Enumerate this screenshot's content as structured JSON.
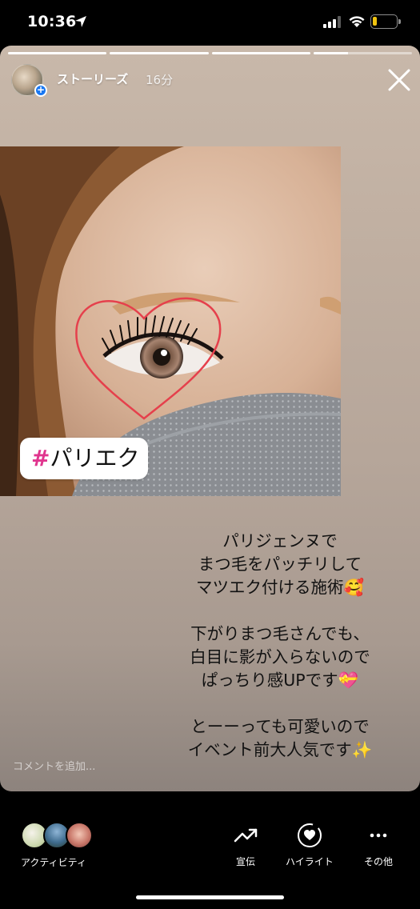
{
  "status_bar": {
    "time": "10:36",
    "battery": "17",
    "battery_color": "#f1c40f",
    "icons": [
      "location-arrow-icon",
      "cellular-signal-icon",
      "wifi-icon",
      "battery-icon"
    ]
  },
  "story": {
    "progress": [
      1.0,
      1.0,
      1.0,
      0.35
    ],
    "account_name": "ストーリーズ",
    "time_ago": "16分",
    "hashtag_symbol": "#",
    "hashtag_text": "パリエク",
    "hashtag_color": "#e0358e",
    "caption": {
      "p1": [
        "パリジェンヌで",
        "まつ毛をパッチリして",
        "マツエク付ける施術🥰"
      ],
      "p2": [
        "下がりまつ毛さんでも、",
        "白目に影が入らないので",
        "ぱっちり感UPです💝"
      ],
      "p3": [
        "とーーっても可愛いので",
        "イベント前大人気です✨"
      ]
    },
    "comment_placeholder": "コメントを追加..."
  },
  "bottom_bar": {
    "activity_label": "アクティビティ",
    "promote_label": "宣伝",
    "highlight_label": "ハイライト",
    "more_label": "その他"
  }
}
